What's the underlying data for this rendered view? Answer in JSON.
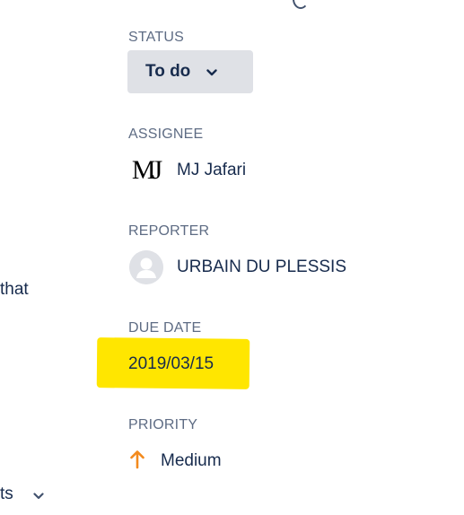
{
  "left_panel": {
    "fragment_that": "that",
    "fragment_ts": "ts"
  },
  "status": {
    "label": "STATUS",
    "value": "To do"
  },
  "assignee": {
    "label": "ASSIGNEE",
    "avatar_text": "MJ",
    "name": "MJ Jafari"
  },
  "reporter": {
    "label": "REPORTER",
    "name": "URBAIN DU PLESSIS"
  },
  "due_date": {
    "label": "DUE DATE",
    "value": "2019/03/15",
    "highlight_color": "#FFE600"
  },
  "priority": {
    "label": "PRIORITY",
    "value": "Medium",
    "icon": "arrow-up-icon",
    "icon_color": "#F38A1D"
  }
}
